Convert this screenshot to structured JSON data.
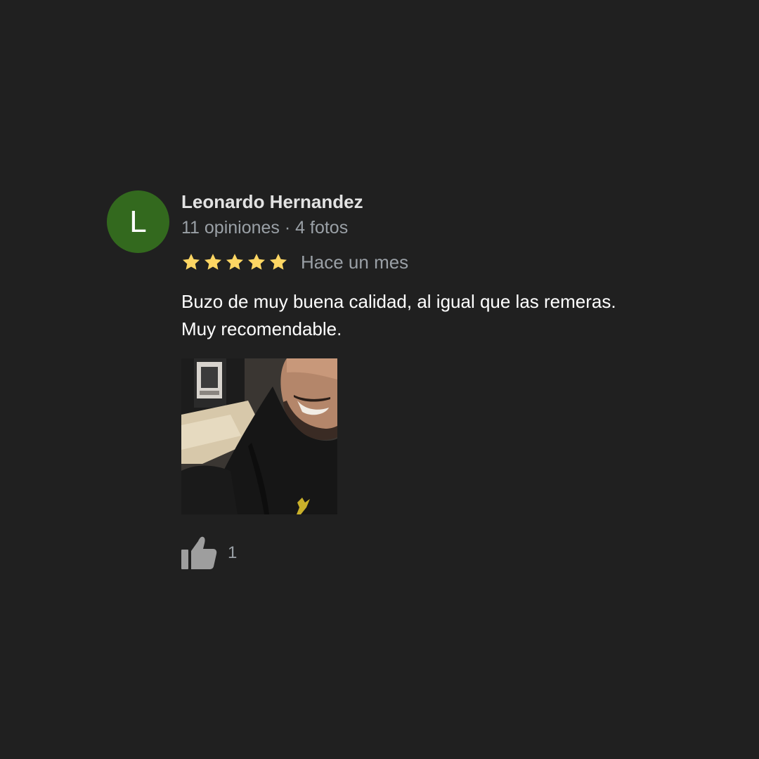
{
  "review": {
    "avatar_letter": "L",
    "avatar_color": "#33691e",
    "author_name": "Leonardo Hernandez",
    "author_meta": "11 opiniones · 4 fotos",
    "rating": 5,
    "rating_max": 5,
    "star_color": "#fdd663",
    "time_ago": "Hace un mes",
    "text_line1": "Buzo de muy buena calidad, al igual que las remeras.",
    "text_line2": "Muy recomendable.",
    "photo_icon": "review-photo",
    "like_icon": "thumbs-up-icon",
    "like_count": "1"
  }
}
